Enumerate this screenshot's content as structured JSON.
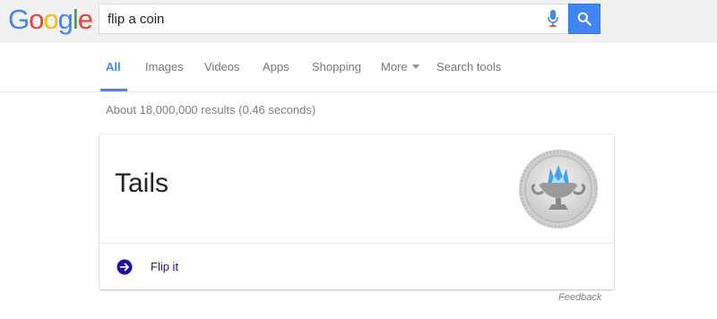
{
  "logo": {
    "letters": [
      "G",
      "o",
      "o",
      "g",
      "l",
      "e"
    ],
    "colors": [
      "#4285f4",
      "#ea4335",
      "#fbbc05",
      "#4285f4",
      "#34a853",
      "#ea4335"
    ]
  },
  "search": {
    "query": "flip a coin",
    "button_color": "#4285f4"
  },
  "tabs": [
    {
      "label": "All",
      "active": true
    },
    {
      "label": "Images"
    },
    {
      "label": "Videos"
    },
    {
      "label": "Apps"
    },
    {
      "label": "Shopping"
    },
    {
      "label": "More"
    },
    {
      "label": "Search tools"
    }
  ],
  "stats": "About 18,000,000 results (0.46 seconds)",
  "card": {
    "result": "Tails",
    "action_label": "Flip it"
  },
  "feedback": "Feedback",
  "colors": {
    "link": "#1a0dab",
    "accent": "#4285f4",
    "action_icon": "#1a0dab"
  }
}
